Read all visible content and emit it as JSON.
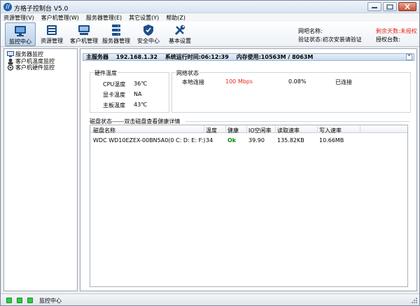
{
  "window": {
    "title": "方格子控制台 V5.0",
    "icon_letter": "//"
  },
  "menu": [
    {
      "label": "资源管理(V)"
    },
    {
      "label": "客户机管理(W)"
    },
    {
      "label": "服务器管理(E)"
    },
    {
      "label": "其它设置(Y)"
    },
    {
      "label": "帮助(Z)"
    }
  ],
  "toolbar": {
    "buttons": [
      {
        "label": "监控中心",
        "icon": "monitor-icon",
        "active": true
      },
      {
        "label": "资源管理",
        "icon": "folder-icon",
        "active": false
      },
      {
        "label": "客户机管理",
        "icon": "client-computer-icon",
        "active": false
      },
      {
        "label": "服务器管理",
        "icon": "server-icon",
        "active": false
      },
      {
        "label": "安全中心",
        "icon": "shield-icon",
        "active": false
      },
      {
        "label": "基本设置",
        "icon": "tools-icon",
        "active": false
      }
    ],
    "info": {
      "netbar_name_label": "网吧名称:",
      "verify_status": "验证状态:初次安装请验证",
      "remaining_days": "剩余天数:未授权",
      "auth_count": "授权台数:"
    }
  },
  "tree": {
    "items": [
      {
        "label": "服务器监控",
        "icon": "server-monitor-icon"
      },
      {
        "label": "客户机温度监控",
        "icon": "client-temp-icon"
      },
      {
        "label": "客户机硬件监控",
        "icon": "client-hardware-icon"
      }
    ]
  },
  "server": {
    "label": "主服务器",
    "ip": "192.168.1.32",
    "uptime": "系统运行时间:06:12:39",
    "memory": "内存使用:10563M / 8063M",
    "collapse_glyph": "⌃"
  },
  "hardware": {
    "title": "硬件温度",
    "cpu_label": "CPU温度",
    "cpu_value": "36℃",
    "gpu_label": "显卡温度",
    "gpu_value": "NA",
    "board_label": "主板温度",
    "board_value": "43℃"
  },
  "network": {
    "title": "网络状态",
    "name": "本地连接",
    "speed": "100 Mbps",
    "usage": "0.08%",
    "status": "已连接"
  },
  "disk": {
    "section_label": "磁盘状态------双击磁盘查看健康详情",
    "columns": [
      "磁盘名称",
      "温度",
      "健康",
      "IO空闲率",
      "读取速率",
      "写入速率"
    ],
    "rows": [
      {
        "name": "WDC WD10EZEX-00BN5A0(0 C: D: E: F:)",
        "temp": "34",
        "health": "Ok",
        "io_idle": "39.90",
        "read": "135.82KB",
        "write": "10.66MB"
      }
    ]
  },
  "statusbar": {
    "text": "监控中心"
  },
  "colors": {
    "accent_red": "#e8261c",
    "ok_green": "#0a8a0a",
    "led_green": "#2ecc40"
  }
}
